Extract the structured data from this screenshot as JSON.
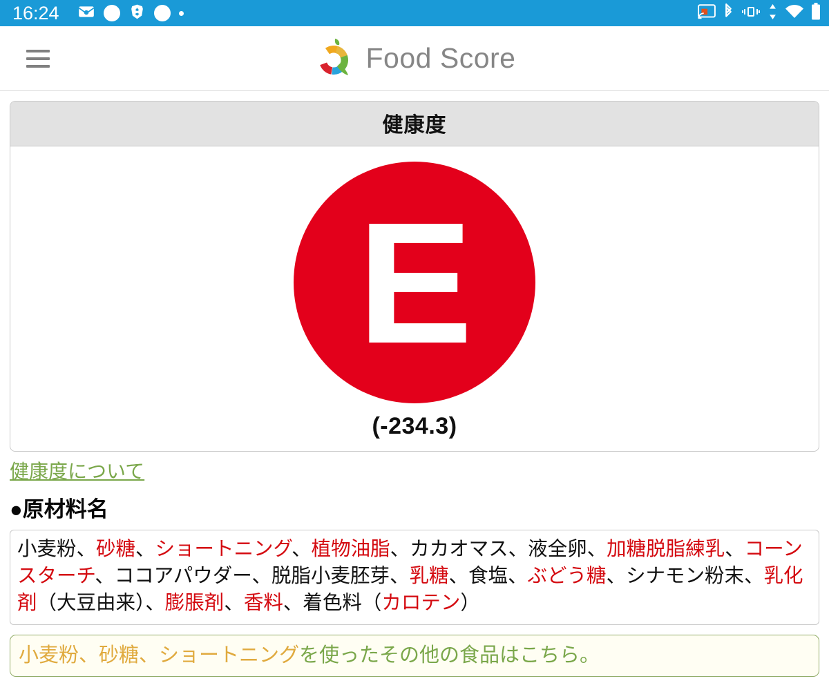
{
  "statusbar": {
    "time": "16:24",
    "left_icons": [
      "mail-photo-icon",
      "white-circle-icon",
      "brave-browser-icon",
      "white-circle-icon",
      "small-dot-icon"
    ],
    "right_icons": [
      "cast-screen-icon",
      "bluetooth-icon",
      "vibrate-icon",
      "data-transfer-icon",
      "wifi-icon",
      "battery-icon"
    ],
    "background_color": "#1a9ad7"
  },
  "appbar": {
    "menu_icon": "hamburger-menu-icon",
    "brand_name": "Food Score",
    "logo_icon": "food-score-logo-icon",
    "brand_color": "#868686"
  },
  "score_card": {
    "title": "健康度",
    "grade": "E",
    "grade_color": "#e3001b",
    "score": "(-234.3)"
  },
  "about_link": {
    "label": "健康度について",
    "color": "#7aa74a"
  },
  "ingredients": {
    "heading": "●原材料名",
    "highlight_color": "#d40a10",
    "segments": [
      {
        "text": "小麦粉、",
        "highlight": false
      },
      {
        "text": "砂糖",
        "highlight": true
      },
      {
        "text": "、",
        "highlight": false
      },
      {
        "text": "ショートニング",
        "highlight": true
      },
      {
        "text": "、",
        "highlight": false
      },
      {
        "text": "植物油脂",
        "highlight": true
      },
      {
        "text": "、カカオマス、液全卵、",
        "highlight": false
      },
      {
        "text": "加糖脱脂練乳",
        "highlight": true
      },
      {
        "text": "、",
        "highlight": false
      },
      {
        "text": "コーンスターチ",
        "highlight": true
      },
      {
        "text": "、ココアパウダー、脱脂小麦胚芽、",
        "highlight": false
      },
      {
        "text": "乳糖",
        "highlight": true
      },
      {
        "text": "、食塩、",
        "highlight": false
      },
      {
        "text": "ぶどう糖",
        "highlight": true
      },
      {
        "text": "、シナモン粉末、",
        "highlight": false
      },
      {
        "text": "乳化剤",
        "highlight": true
      },
      {
        "text": "（大豆由来）、",
        "highlight": false
      },
      {
        "text": "膨脹剤",
        "highlight": true
      },
      {
        "text": "、",
        "highlight": false
      },
      {
        "text": "香料",
        "highlight": true
      },
      {
        "text": "、着色料（",
        "highlight": false
      },
      {
        "text": "カロテン",
        "highlight": true
      },
      {
        "text": "）",
        "highlight": false
      }
    ],
    "full_text": "小麦粉、砂糖、ショートニング、植物油脂、カカオマス、液全卵、加糖脱脂練乳、コーンスターチ、ココアパウダー、脱脂小麦胚芽、乳糖、食塩、ぶどう糖、シナモン粉末、乳化剤（大豆由来）、膨脹剤、香料、着色料（カロテン）"
  },
  "related_link": {
    "ingredient_part": "小麦粉、砂糖、ショートニング",
    "rest_part": "を使ったその他の食品はこちら。",
    "ingredient_color": "#e0aa3e",
    "text_color": "#7aa74a",
    "border_color": "#93ad6a"
  }
}
